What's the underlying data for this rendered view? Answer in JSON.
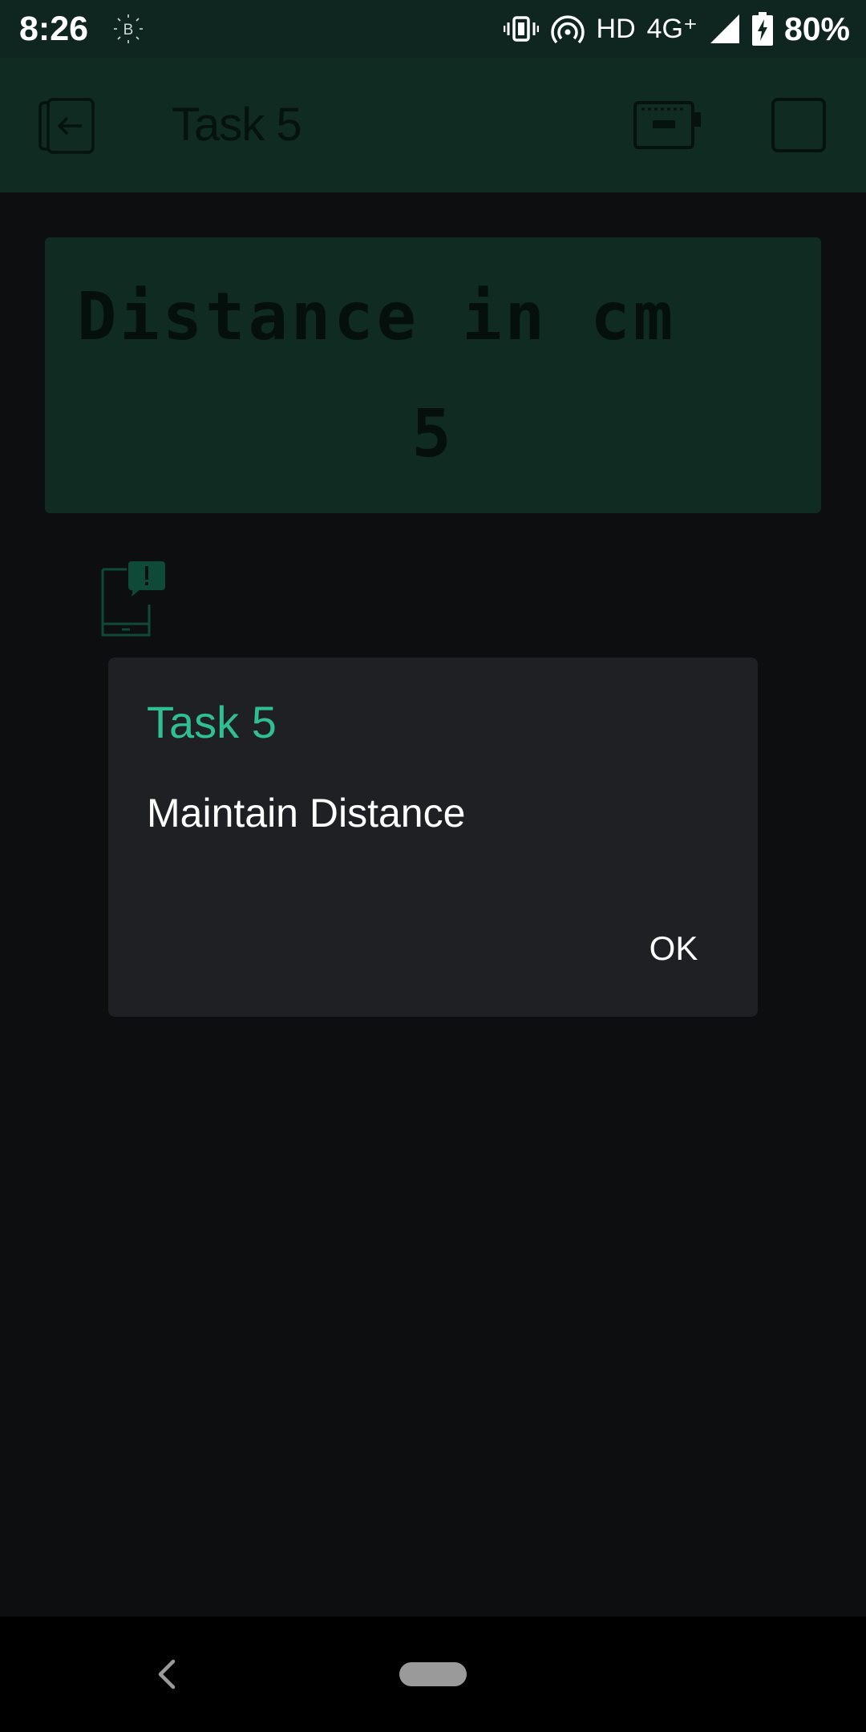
{
  "status_bar": {
    "time": "8:26",
    "network": "HD",
    "signal": "4G⁺",
    "battery": "80%"
  },
  "app_bar": {
    "title": "Task 5"
  },
  "lcd": {
    "line1": "Distance in cm",
    "line2": "5"
  },
  "dialog": {
    "title": "Task 5",
    "message": "Maintain Distance",
    "ok_label": "OK"
  },
  "colors": {
    "accent": "#2fbf91",
    "app_bar": "#0f2b22",
    "status_bar": "#0f2520",
    "dialog_bg": "#1f2023",
    "screen_bg": "#0d0e10"
  }
}
